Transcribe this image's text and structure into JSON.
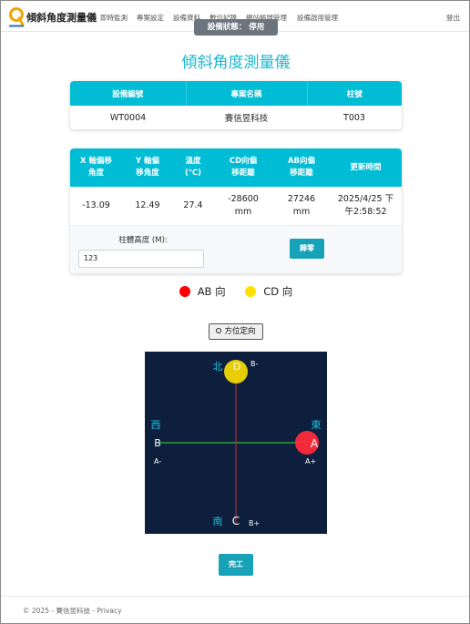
{
  "nav": {
    "brand": "傾斜角度測量儀",
    "links": [
      "即時監測",
      "專案設定",
      "設備資料",
      "數位記錄",
      "網站帳號管理",
      "設備啟用管理"
    ],
    "logout": "登出"
  },
  "status_pill": "設備狀態： 停用",
  "page_title": "傾斜角度測量儀",
  "device_table": {
    "headers": [
      "設備編號",
      "專案名稱",
      "柱號"
    ],
    "row": [
      "WT0004",
      "賽信昱科技",
      "T003"
    ]
  },
  "reading_table": {
    "headers": [
      [
        "X 軸偏移",
        "角度"
      ],
      [
        "Y 軸偏",
        "移角度"
      ],
      [
        "溫度",
        "(℃)"
      ],
      [
        "CD向偏",
        "移距離"
      ],
      [
        "AB向偏",
        "移距離"
      ],
      [
        "更新時間"
      ]
    ],
    "row": [
      [
        "-13.09"
      ],
      [
        "12.49"
      ],
      [
        "27.4"
      ],
      [
        "-28600",
        "mm"
      ],
      [
        "27246",
        "mm"
      ],
      [
        "2025/4/25 下",
        "午2:58:52"
      ]
    ]
  },
  "height": {
    "label": "柱體高度 (M):",
    "value": "123",
    "reset_label": "歸零"
  },
  "legend": {
    "ab": {
      "label": "AB 向",
      "color": "#ff0000"
    },
    "cd": {
      "label": "CD 向",
      "color": "#ffe000"
    }
  },
  "orient_label": "方位定向",
  "compass": {
    "north": "北",
    "south": "南",
    "west": "西",
    "east": "東",
    "point_a": "A",
    "point_b": "B",
    "point_c": "C",
    "point_d": "D",
    "a_minus": "A-",
    "a_plus": "A+",
    "b_minus": "B-",
    "b_plus": "B+",
    "bg_color": "#0d1f3c",
    "cd_level": 0.05,
    "ab_level": 0.95
  },
  "finish_label": "完工",
  "footer": "© 2025 - 賽信昱科技 - Privacy"
}
